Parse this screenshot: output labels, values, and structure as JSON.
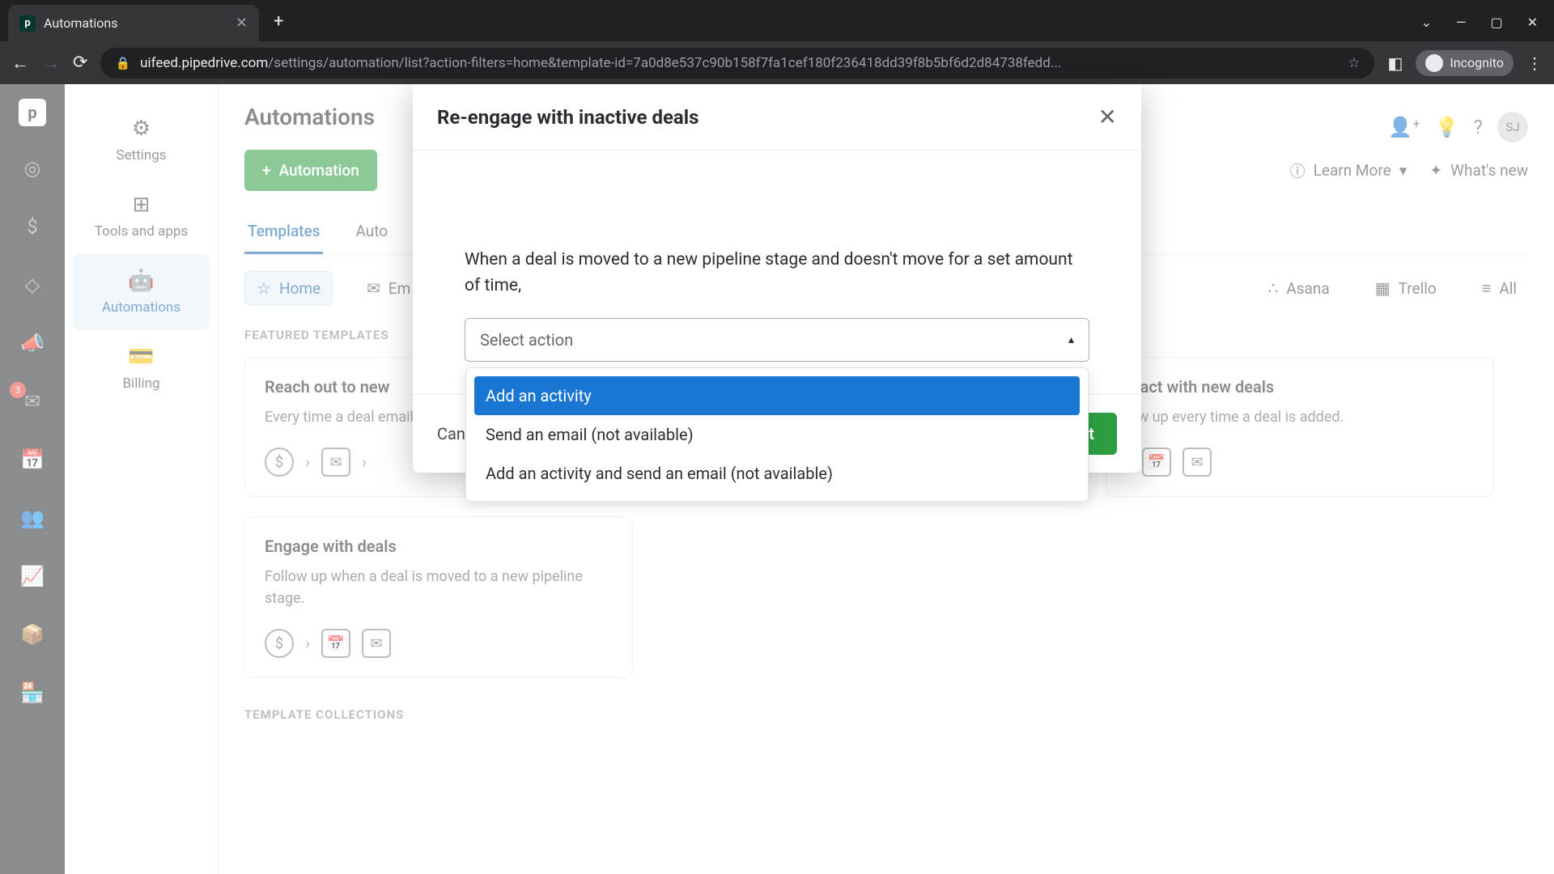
{
  "browser": {
    "tab_title": "Automations",
    "url_domain": "uifeed.pipedrive.com",
    "url_path": "/settings/automation/list?action-filters=home&template-id=7a0d8e537c90b158f7fa1cef180f236418dd39f8b5bf6d2d84738fedd...",
    "incognito_label": "Incognito"
  },
  "left_rail": {
    "badge_count": "3"
  },
  "settings_nav": {
    "items": [
      {
        "label": "Settings",
        "icon": "⚙"
      },
      {
        "label": "Tools and apps",
        "icon": "⊞"
      },
      {
        "label": "Automations",
        "icon": "🤖"
      },
      {
        "label": "Billing",
        "icon": "💳"
      }
    ]
  },
  "header": {
    "page_title": "Automations",
    "avatar": "SJ"
  },
  "actions": {
    "automation_label": "Automation",
    "learn_more": "Learn More",
    "whats_new": "What's new"
  },
  "tabs": [
    {
      "label": "Templates",
      "active": true
    },
    {
      "label": "Auto"
    }
  ],
  "filters": [
    {
      "label": "Home",
      "icon": "☆",
      "active": true
    },
    {
      "label": "Em",
      "icon": "✉"
    },
    {
      "label": "Asana",
      "icon": "∴"
    },
    {
      "label": "Trello",
      "icon": "▦"
    },
    {
      "label": "All",
      "icon": "≡"
    }
  ],
  "sections": {
    "featured_label": "FEATURED TEMPLATES",
    "collections_label": "TEMPLATE COLLECTIONS"
  },
  "templates": [
    {
      "title": "Reach out to new",
      "desc": "Every time a deal email sequence"
    },
    {
      "title": "eract with new deals",
      "desc": "low up every time a deal is added."
    },
    {
      "title": "Engage with deals",
      "desc": "Follow up when a deal is moved to a new pipeline stage."
    }
  ],
  "modal": {
    "title": "Re-engage with inactive deals",
    "prompt": "When a deal is moved to a new pipeline stage and doesn't move for a set amount of time,",
    "select_placeholder": "Select action",
    "options": [
      "Add an activity",
      "Send an email (not available)",
      "Add an activity and send an email (not available)"
    ],
    "cancel": "Cancel",
    "next": "Next"
  }
}
